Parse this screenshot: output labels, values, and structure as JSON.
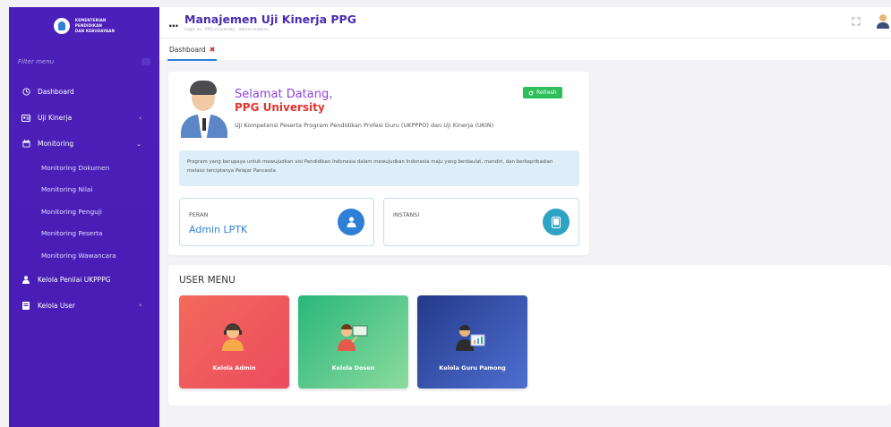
{
  "sidebar": {
    "logo_lines": [
      "KEMENTERIAN",
      "PENDIDIKAN",
      "DAN KEBUDAYAAN"
    ],
    "filter_placeholder": "Filter menu",
    "items": [
      {
        "label": "Dashboard",
        "icon": "clock-icon"
      },
      {
        "label": "Uji Kinerja",
        "icon": "id-card-icon",
        "caret": "‹"
      },
      {
        "label": "Monitoring",
        "icon": "calendar-icon",
        "caret": "⌄"
      }
    ],
    "monitoring_sub": [
      "Monitoring Dokumen",
      "Monitoring Nilai",
      "Monitoring Penguji",
      "Monitoring Peserta",
      "Monitoring Wawancara"
    ],
    "items_after": [
      {
        "label": "Kelola Penilai UKPPPG",
        "icon": "user-icon"
      },
      {
        "label": "Kelola User",
        "icon": "book-icon",
        "caret": "‹"
      }
    ]
  },
  "header": {
    "dots": "...",
    "title": "Manajemen Uji Kinerja PPG",
    "subtitle": "Login as : PPG University - admin-instansi"
  },
  "tabs": [
    {
      "label": "Dashboard",
      "close": "✖"
    }
  ],
  "welcome": {
    "greeting": "Selamat Datang,",
    "name": "PPG University",
    "description": "Uji Kompetensi Peserta Program Pendidikan Profesi Guru (UKPPPO) dan Uji Kinerja (UKIN)",
    "refresh_label": "Refresh",
    "info": "Program yang berupaya untuk mewujudkan visi Pendidikan Indonesia dalam mewujudkan Indonesia maju yang berdaulat, mandiri, dan berkepribadian melalui terciptanya Pelajar Pancasila",
    "peran_label": "PERAN",
    "peran_value": "Admin LPTK",
    "instansi_label": "INSTANSI",
    "instansi_value": ""
  },
  "user_menu": {
    "title": "USER MENU",
    "cards": [
      {
        "label": "Kelola Admin",
        "icon": "admin-person-icon"
      },
      {
        "label": "Kelola Dosen",
        "icon": "lecturer-board-icon"
      },
      {
        "label": "Kelola Guru Pamong",
        "icon": "teacher-chart-icon"
      }
    ]
  },
  "colors": {
    "sidebar": "#4a1fb8",
    "title": "#4a2bb0",
    "accent_blue": "#2f7fd6",
    "refresh_green": "#2cbf5a",
    "greeting_purple": "#8e44e0",
    "name_red": "#e0342f"
  }
}
